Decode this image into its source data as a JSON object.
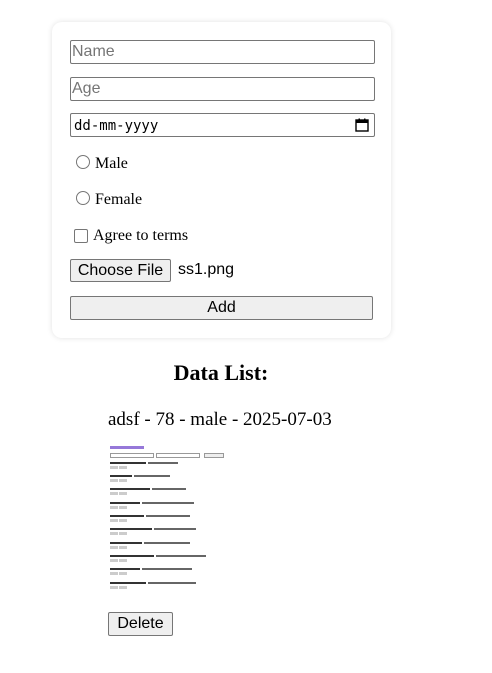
{
  "form": {
    "name_placeholder": "Name",
    "age_placeholder": "Age",
    "date_placeholder": "dd-mm-yyyy",
    "gender_options": [
      "Male",
      "Female"
    ],
    "terms_label": "Agree to terms",
    "choose_file_label": "Choose File",
    "file_name": "ss1.png",
    "add_label": "Add"
  },
  "list": {
    "title": "Data List:",
    "items": [
      {
        "text": "adsf - 78 - male - 2025-07-03",
        "delete_label": "Delete"
      }
    ]
  }
}
